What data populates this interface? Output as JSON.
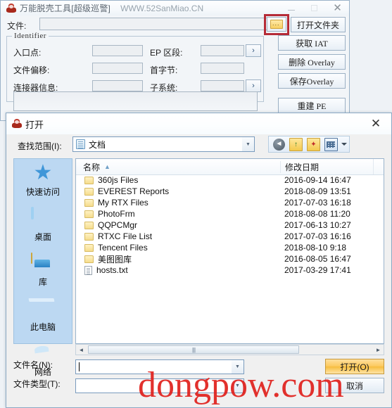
{
  "main_window": {
    "title": "万能脱壳工具[超级巡警]",
    "subtitle": "WWW.52SanMiao.CN",
    "icon": "app-shell-icon",
    "window_buttons": {
      "minimize": "–",
      "maximize": "□",
      "close": "✕"
    },
    "file_row": {
      "label": "文件:",
      "value": "",
      "browse_icon": "folder-browse-icon",
      "open_folder_label": "打开文件夹",
      "highlight_color": "#b52b37"
    },
    "identifier_group": {
      "legend": "Identifier",
      "fields": [
        {
          "label": "入口点:",
          "value": ""
        },
        {
          "label": "文件偏移:",
          "value": ""
        },
        {
          "label": "连接器信息:",
          "value": ""
        },
        {
          "label": "EP  区段:",
          "value": ""
        },
        {
          "label": "首字节:",
          "value": ""
        },
        {
          "label": "子系统:",
          "value": ""
        }
      ],
      "arrow_label": "›",
      "textarea_value": ""
    },
    "side_buttons": [
      {
        "label": "获取 IAT"
      },
      {
        "label": "删除 Overlay"
      },
      {
        "label": "保存Overlay"
      },
      {
        "label": "重建 PE"
      }
    ]
  },
  "open_dialog": {
    "title": "打开",
    "icon": "app-shell-icon",
    "close_label": "✕",
    "lookin": {
      "label": "查找范围(I):",
      "value": "文档",
      "icon": "documents-icon",
      "arrow": "▼"
    },
    "toolbar": [
      {
        "name": "back-icon",
        "glyph": "◄"
      },
      {
        "name": "up-folder-icon",
        "glyph": "↑"
      },
      {
        "name": "new-folder-icon",
        "glyph": "✦"
      },
      {
        "name": "view-mode-icon",
        "glyph": ""
      }
    ],
    "places": [
      {
        "label": "快速访问",
        "icon": "quick-access-star-icon"
      },
      {
        "label": "桌面",
        "icon": "desktop-icon"
      },
      {
        "label": "库",
        "icon": "libraries-icon"
      },
      {
        "label": "此电脑",
        "icon": "this-pc-icon"
      },
      {
        "label": "网络",
        "icon": "network-icon"
      }
    ],
    "list": {
      "columns": [
        "名称",
        "修改日期"
      ],
      "sort_arrow": "▲",
      "rows": [
        {
          "name": "360js Files",
          "date": "2016-09-14 16:47",
          "kind": "folder"
        },
        {
          "name": "EVEREST Reports",
          "date": "2018-08-09 13:51",
          "kind": "folder"
        },
        {
          "name": "My RTX Files",
          "date": "2017-07-03 16:18",
          "kind": "folder"
        },
        {
          "name": "PhotoFrm",
          "date": "2018-08-08 11:20",
          "kind": "folder"
        },
        {
          "name": "QQPCMgr",
          "date": "2017-06-13 10:27",
          "kind": "folder"
        },
        {
          "name": "RTXC File List",
          "date": "2017-07-03 16:16",
          "kind": "folder"
        },
        {
          "name": "Tencent Files",
          "date": "2018-08-10 9:18",
          "kind": "folder"
        },
        {
          "name": "美图图库",
          "date": "2016-08-05 16:47",
          "kind": "folder"
        },
        {
          "name": "hosts.txt",
          "date": "2017-03-29 17:41",
          "kind": "file"
        }
      ]
    },
    "scrollbar": {
      "left_arrow": "◄",
      "right_arrow": "►",
      "grip": "||||"
    },
    "filename": {
      "label": "文件名(N):",
      "value": "",
      "arrow": "▼"
    },
    "filetype": {
      "label": "文件类型(T):",
      "value": "",
      "arrow": "▼"
    },
    "open_button": "打开(O)",
    "cancel_button": "取消"
  },
  "watermark": {
    "text_a": "dongpow",
    "dot": ".",
    "text_b": "com",
    "color": "#e0201c"
  }
}
